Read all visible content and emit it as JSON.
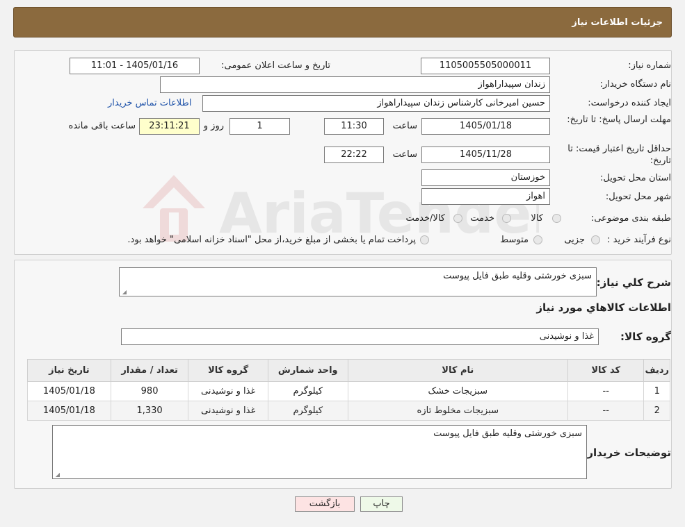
{
  "header": {
    "title": "جزئیات اطلاعات نیاز"
  },
  "info": {
    "need_number_label": "شماره نیاز:",
    "need_number": "1105005505000011",
    "announce_label": "تاریخ و ساعت اعلان عمومی:",
    "announce_value": "1405/01/16 - 11:01",
    "buyer_org_label": "نام دستگاه خریدار:",
    "buyer_org": "زندان سپیداراهواز",
    "creator_label": "ایجاد کننده درخواست:",
    "creator": "حسین امیرخانی کارشناس زندان سپیداراهواز",
    "contact_link": "اطلاعات تماس خریدار",
    "deadline_label": "مهلت ارسال پاسخ: تا تاریخ:",
    "deadline_date": "1405/01/18",
    "time_label": "ساعت",
    "deadline_time": "11:30",
    "days_value": "1",
    "days_label": "روز و",
    "remaining_time": "23:11:21",
    "remaining_label": "ساعت باقی مانده",
    "validity_label": "حداقل تاریخ اعتبار قیمت: تا تاریخ:",
    "validity_date": "1405/11/28",
    "validity_time": "22:22",
    "province_label": "استان محل تحویل:",
    "province": "خوزستان",
    "city_label": "شهر محل تحویل:",
    "city": "اهواز",
    "category_label": "طبقه بندی موضوعی:",
    "category_options": [
      "کالا",
      "خدمت",
      "کالا/خدمت"
    ],
    "process_label": "نوع فرآیند خرید :",
    "process_options": [
      "جزیی",
      "متوسط"
    ],
    "process_note": "پرداخت تمام یا بخشی از مبلغ خرید،از محل \"اسناد خزانه اسلامی\" خواهد بود."
  },
  "watermark": {
    "text": "AriaTender.neT"
  },
  "details": {
    "summary_label": "شرح کلي نياز:",
    "summary": "سبزی خورشتی وقلیه طبق فایل پیوست",
    "goods_info_title": "اطلاعات کالاهاي مورد نياز",
    "goods_group_label": "گروه کالا:",
    "goods_group": "غذا و نوشیدنی",
    "table": {
      "headers": [
        "ردیف",
        "کد کالا",
        "نام کالا",
        "واحد شمارش",
        "گروه کالا",
        "تعداد / مقدار",
        "تاریخ نیاز"
      ],
      "rows": [
        [
          "1",
          "--",
          "سبزیجات خشک",
          "کیلوگرم",
          "غذا و نوشیدنی",
          "980",
          "1405/01/18"
        ],
        [
          "2",
          "--",
          "سبزیجات مخلوط تازه",
          "کیلوگرم",
          "غذا و نوشیدنی",
          "1,330",
          "1405/01/18"
        ]
      ]
    },
    "buyer_notes_label": "توضیحات خریدار:",
    "buyer_notes": "سبزی خورشتی وقلیه طبق فایل پیوست"
  },
  "buttons": {
    "print": "چاپ",
    "back": "بازگشت"
  }
}
